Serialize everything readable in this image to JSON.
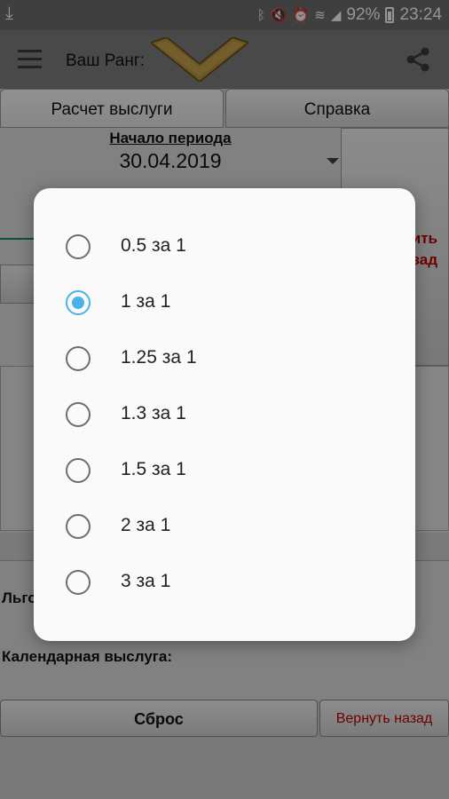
{
  "status_bar": {
    "battery": "92%",
    "time": "23:24"
  },
  "toolbar": {
    "rank_label": "Ваш Ранг:"
  },
  "tabs": [
    {
      "label": "Расчет выслуги"
    },
    {
      "label": "Справка"
    }
  ],
  "period": {
    "title": "Начало периода",
    "date": "30.04.2019"
  },
  "labels": {
    "lgot": "Льго",
    "calendar": "Календарная выслуга:"
  },
  "side_button": {
    "line1": "ить",
    "line2": "зад"
  },
  "buttons": {
    "reset": "Сброс",
    "back": "Вернуть назад"
  },
  "dialog": {
    "options": [
      "0.5 за 1",
      "1 за 1",
      "1.25 за 1",
      "1.3 за 1",
      "1.5 за 1",
      "2 за 1",
      "3 за 1"
    ],
    "selected": "1 за 1"
  },
  "colors": {
    "accent": "#4ab3e8",
    "warning_text": "#c00000",
    "toolbar": "#7f7f7f"
  }
}
